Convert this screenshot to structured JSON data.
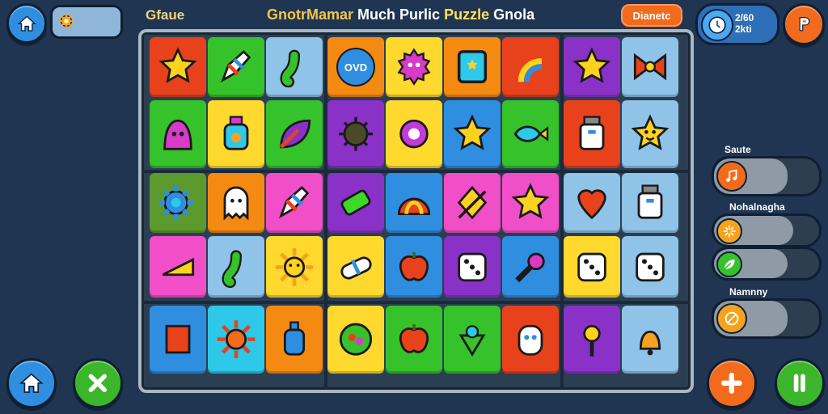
{
  "header": {
    "home_icon": "house-icon",
    "left_title": "Gfaue",
    "main_title_part1": "GnotrMamar",
    "main_title_part2": "Much Purlic",
    "main_title_part3": "Puzzle",
    "main_title_part4": "Gnola",
    "difficulty_button": "Dianetc",
    "timer_line1": "2/60",
    "timer_line2": "2kti"
  },
  "side_panel": {
    "label_1": "Saute",
    "label_2": "Nohalnagha",
    "label_3": "Namnny",
    "meter_1_level": 0.7,
    "meter_2_level": 0.75,
    "meter_3_level": 0.7,
    "meter_4_level": 0.7
  },
  "colors": {
    "background": "#1f3552",
    "board": "#2c3e52",
    "accent_orange": "#f26a1b",
    "accent_green": "#3cb62a",
    "accent_blue": "#2f8ee0"
  },
  "tiles": [
    {
      "color": "#e8421d",
      "icon": "star-icon"
    },
    {
      "color": "#36c22a",
      "icon": "rocket-icon"
    },
    {
      "color": "#8fc3e8",
      "icon": "worm-icon"
    },
    {
      "color": "#f58a12",
      "icon": "label-badge-icon",
      "label": "OVD"
    },
    {
      "color": "#ffd92e",
      "icon": "spiky-monster-icon"
    },
    {
      "color": "#f58a12",
      "icon": "tablet-icon"
    },
    {
      "color": "#e8421d",
      "icon": "rainbow-icon"
    },
    {
      "color": "#8a32c8",
      "icon": "star-icon"
    },
    {
      "color": "#8fc3e8",
      "icon": "bow-icon"
    },
    {
      "color": "#36c22a",
      "icon": "blob-monster-icon"
    },
    {
      "color": "#ffd92e",
      "icon": "potion-icon"
    },
    {
      "color": "#36c22a",
      "icon": "leaf-icon"
    },
    {
      "color": "#8a32c8",
      "icon": "bug-icon"
    },
    {
      "color": "#ffd92e",
      "icon": "heart-gem-icon"
    },
    {
      "color": "#2f8ee0",
      "icon": "star-icon"
    },
    {
      "color": "#36c22a",
      "icon": "fish-icon"
    },
    {
      "color": "#e8421d",
      "icon": "jar-icon"
    },
    {
      "color": "#8fc3e8",
      "icon": "star-face-icon"
    },
    {
      "color": "#5d9a2e",
      "icon": "gear-icon"
    },
    {
      "color": "#f58a12",
      "icon": "ghost-icon"
    },
    {
      "color": "#f04fc8",
      "icon": "rocket-icon"
    },
    {
      "color": "#8a32c8",
      "icon": "eraser-icon"
    },
    {
      "color": "#2f8ee0",
      "icon": "shell-icon"
    },
    {
      "color": "#f04fc8",
      "icon": "kite-icon"
    },
    {
      "color": "#f04fc8",
      "icon": "star-icon"
    },
    {
      "color": "#8fc3e8",
      "icon": "heart-icon"
    },
    {
      "color": "#8fc3e8",
      "icon": "jar-icon"
    },
    {
      "color": "#f04fc8",
      "icon": "cheese-icon"
    },
    {
      "color": "#8fc3e8",
      "icon": "worm-icon"
    },
    {
      "color": "#ffd92e",
      "icon": "sun-icon"
    },
    {
      "color": "#ffd92e",
      "icon": "pill-icon"
    },
    {
      "color": "#2f8ee0",
      "icon": "apple-icon"
    },
    {
      "color": "#8a32c8",
      "icon": "dice-icon"
    },
    {
      "color": "#2f8ee0",
      "icon": "paintbrush-icon"
    },
    {
      "color": "#ffd92e",
      "icon": "dice-icon"
    },
    {
      "color": "#8fc3e8",
      "icon": "dice-icon"
    },
    {
      "color": "#2f8ee0",
      "icon": "scroll-icon"
    },
    {
      "color": "#2ec8e8",
      "icon": "sun-face-icon"
    },
    {
      "color": "#f58a12",
      "icon": "bottle-icon"
    },
    {
      "color": "#ffd92e",
      "icon": "fruit-plate-icon"
    },
    {
      "color": "#36c22a",
      "icon": "apple-icon"
    },
    {
      "color": "#36c22a",
      "icon": "spinning-top-icon"
    },
    {
      "color": "#e8421d",
      "icon": "robot-face-icon"
    },
    {
      "color": "#8a32c8",
      "icon": "sun-wand-icon"
    },
    {
      "color": "#8fc3e8",
      "icon": "bell-icon"
    }
  ],
  "bottom": {
    "home_icon": "house-icon",
    "close_icon": "close-icon",
    "add_icon": "plus-icon",
    "pause_icon": "pause-icon"
  }
}
